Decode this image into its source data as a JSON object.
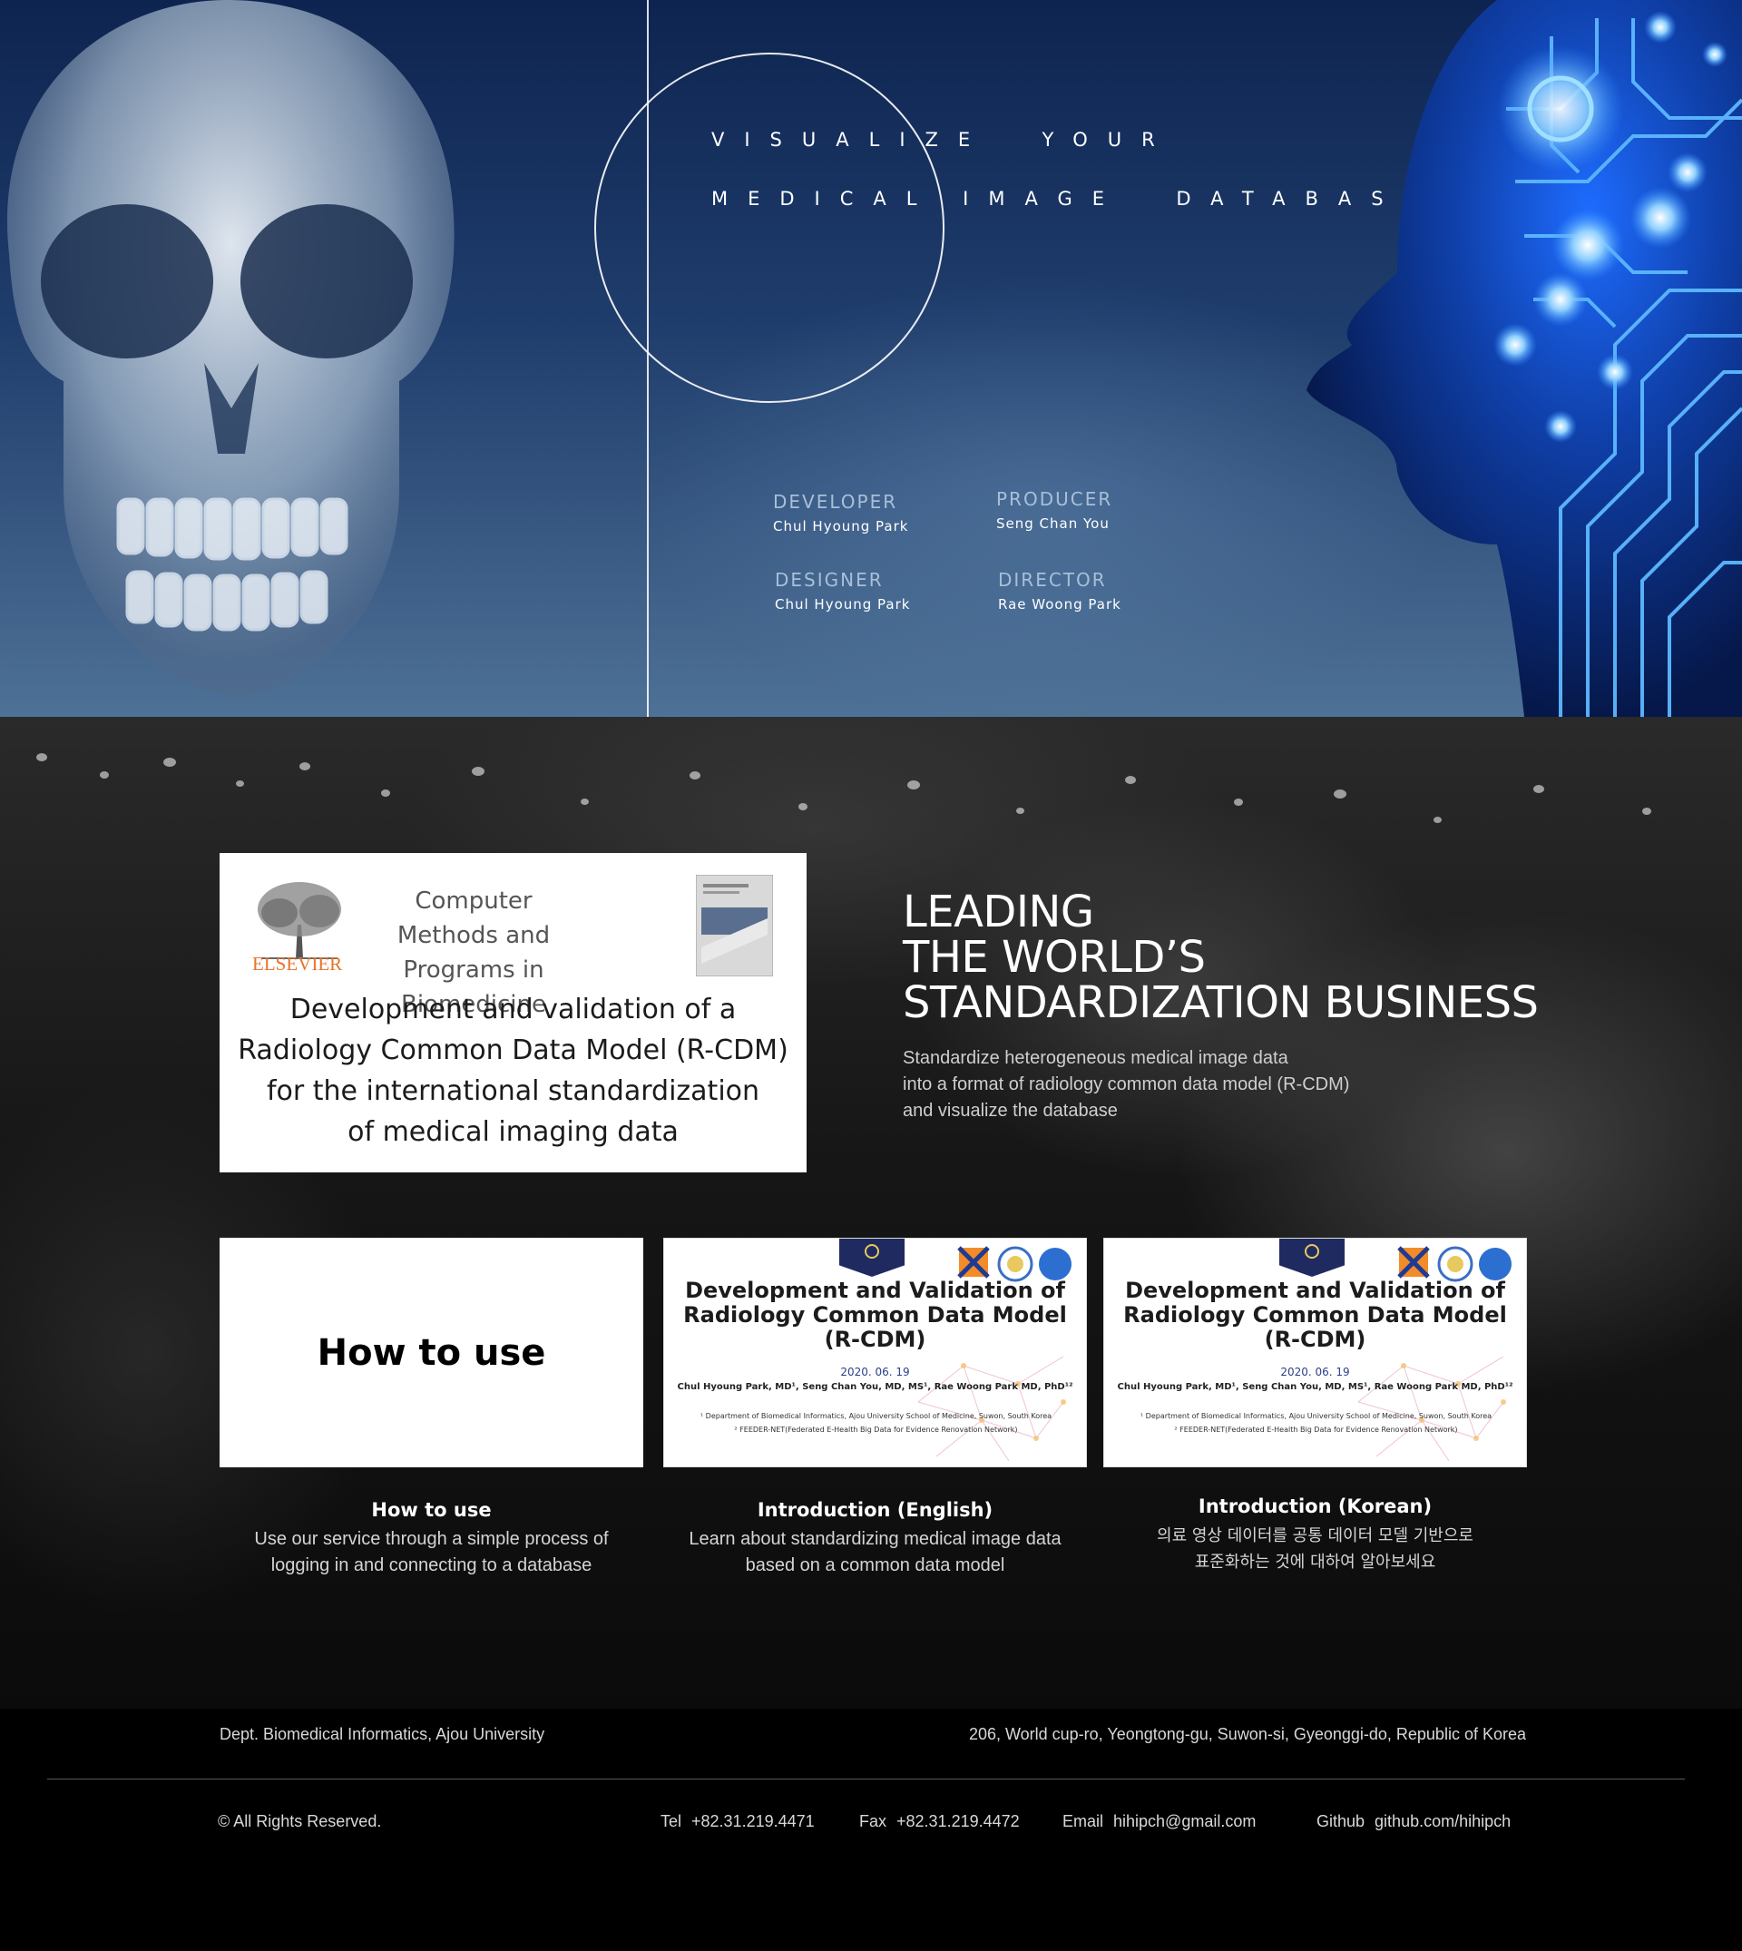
{
  "hero": {
    "tagline_line1": "VISUALIZE  YOUR",
    "tagline_line2": "MEDICAL IMAGE  DATABASE",
    "credits": [
      {
        "role": "DEVELOPER",
        "name": "Chul Hyoung Park"
      },
      {
        "role": "PRODUCER",
        "name": "Seng Chan You"
      },
      {
        "role": "DESIGNER",
        "name": "Chul Hyoung Park"
      },
      {
        "role": "DIRECTOR",
        "name": "Rae Woong Park"
      }
    ]
  },
  "journal_card": {
    "publisher": "ELSEVIER",
    "journal_line1": "Computer Methods and",
    "journal_line2": "Programs in Biomedicine",
    "paper_title_lines": [
      "Development and validation of a",
      "Radiology Common Data Model (R-CDM)",
      "for the international standardization",
      "of medical imaging data"
    ]
  },
  "headline": {
    "lines": [
      "LEADING",
      "THE WORLD’S",
      "STANDARDIZATION BUSINESS"
    ],
    "sub_lines": [
      "Standardize heterogeneous medical image data",
      "into a format of radiology common data model (R-CDM)",
      "and visualize the database"
    ]
  },
  "cards": [
    {
      "thumb_text": "How to use",
      "title": "How to use",
      "desc_lines": [
        "Use our service through a simple process of",
        "logging in and connecting to a database"
      ]
    },
    {
      "slide_title_lines": [
        "Development and Validation of",
        "Radiology Common Data Model",
        "(R-CDM)"
      ],
      "slide_date": "2020. 06. 19",
      "slide_authors": "Chul Hyoung Park, MD¹, Seng Chan You, MD, MS¹, Rae Woong Park MD, PhD¹²",
      "slide_aff_lines": [
        "¹ Department of Biomedical Informatics, Ajou University School of Medicine, Suwon, South Korea",
        "² FEEDER-NET(Federated E-Health Big Data for Evidence Renovation Network)"
      ],
      "title": "Introduction (English)",
      "desc_lines": [
        "Learn about standardizing medical image data",
        "based on a common data model"
      ]
    },
    {
      "slide_title_lines": [
        "Development and Validation of",
        "Radiology Common Data Model",
        "(R-CDM)"
      ],
      "slide_date": "2020. 06. 19",
      "slide_authors": "Chul Hyoung Park, MD¹, Seng Chan You, MD, MS¹, Rae Woong Park MD, PhD¹²",
      "slide_aff_lines": [
        "¹ Department of Biomedical Informatics, Ajou University School of Medicine, Suwon, South Korea",
        "² FEEDER-NET(Federated E-Health Big Data for Evidence Renovation Network)"
      ],
      "title": "Introduction (Korean)",
      "desc_lines": [
        "의료 영상 데이터를 공통 데이터 모델 기반으로",
        "표준화하는 것에 대하여 알아보세요"
      ]
    }
  ],
  "footer": {
    "dept": "Dept. Biomedical Informatics, Ajou University",
    "address": "206, World cup-ro, Yeongtong-gu, Suwon-si, Gyeonggi-do, Republic of Korea",
    "copyright": "© All Rights Reserved.",
    "tel_label": "Tel",
    "tel": "+82.31.219.4471",
    "fax_label": "Fax",
    "fax": "+82.31.219.4472",
    "email_label": "Email",
    "email": "hihipch@gmail.com",
    "github_label": "Github",
    "github": "github.com/hihipch"
  },
  "colors": {
    "hero_top": "#0e2450",
    "hero_bottom": "#4e7196",
    "circuit_blue": "#2f8cff",
    "elsevier_orange": "#e8732a",
    "footer_bg": "#000000"
  },
  "icons": [
    "skull-xray-illustration",
    "ai-circuit-head-illustration",
    "elsevier-tree-logo",
    "journal-cover-icon",
    "ohdsi-logo-icon"
  ]
}
